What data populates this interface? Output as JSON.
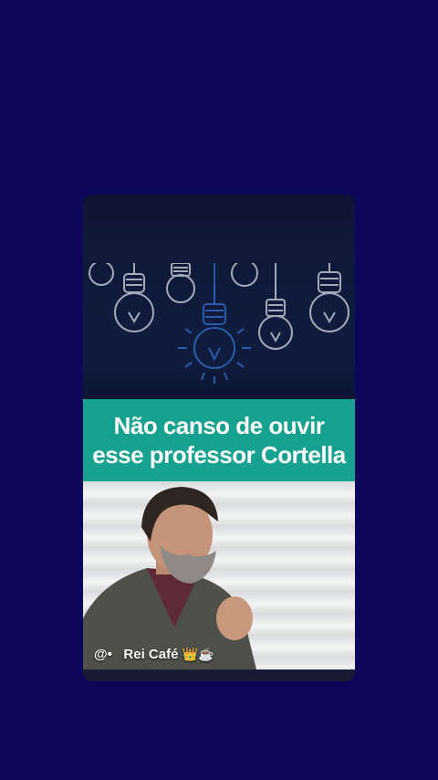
{
  "post": {
    "banner_line1": "Não canso de ouvir",
    "banner_line2": "esse professor Cortella",
    "handle_prefix": "@•",
    "handle_name": "Rei Café",
    "handle_emojis": "👑☕"
  },
  "colors": {
    "background": "#0c075a",
    "banner": "#16a28e",
    "banner_text": "#ffffff",
    "bulb_stroke": "#a4abb8",
    "bulb_center": "#1d3f86"
  },
  "icons": [
    "lightbulb-icon",
    "crown-emoji",
    "coffee-emoji"
  ]
}
